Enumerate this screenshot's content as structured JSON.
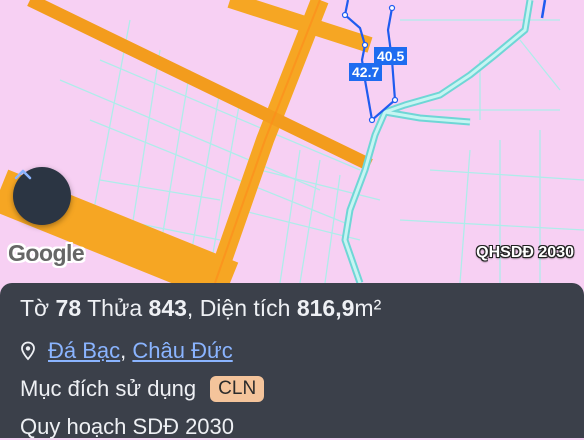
{
  "map": {
    "brand": "Google",
    "layer_label": "QHSDĐ 2030",
    "edge_labels": [
      "40.5",
      "42.7"
    ],
    "colors": {
      "land": "#f7d0f3",
      "road": "#f6a623",
      "water": "#90e8e6",
      "parcel_outline": "#1f5cf0"
    },
    "icons": {
      "expand": "chevron-up-icon"
    }
  },
  "panel": {
    "sheet_label": "Tờ",
    "sheet_no": "78",
    "plot_label": "Thửa",
    "plot_no": "843",
    "area_label": "Diện tích",
    "area_value": "816,9",
    "area_unit": "m²",
    "location": {
      "ward": "Đá Bạc",
      "district": "Châu Đức",
      "icon": "map-pin-icon"
    },
    "land_use_label": "Mục đích sử dụng",
    "land_use_code": "CLN",
    "planning_label": "Quy hoạch SDĐ 2030"
  }
}
